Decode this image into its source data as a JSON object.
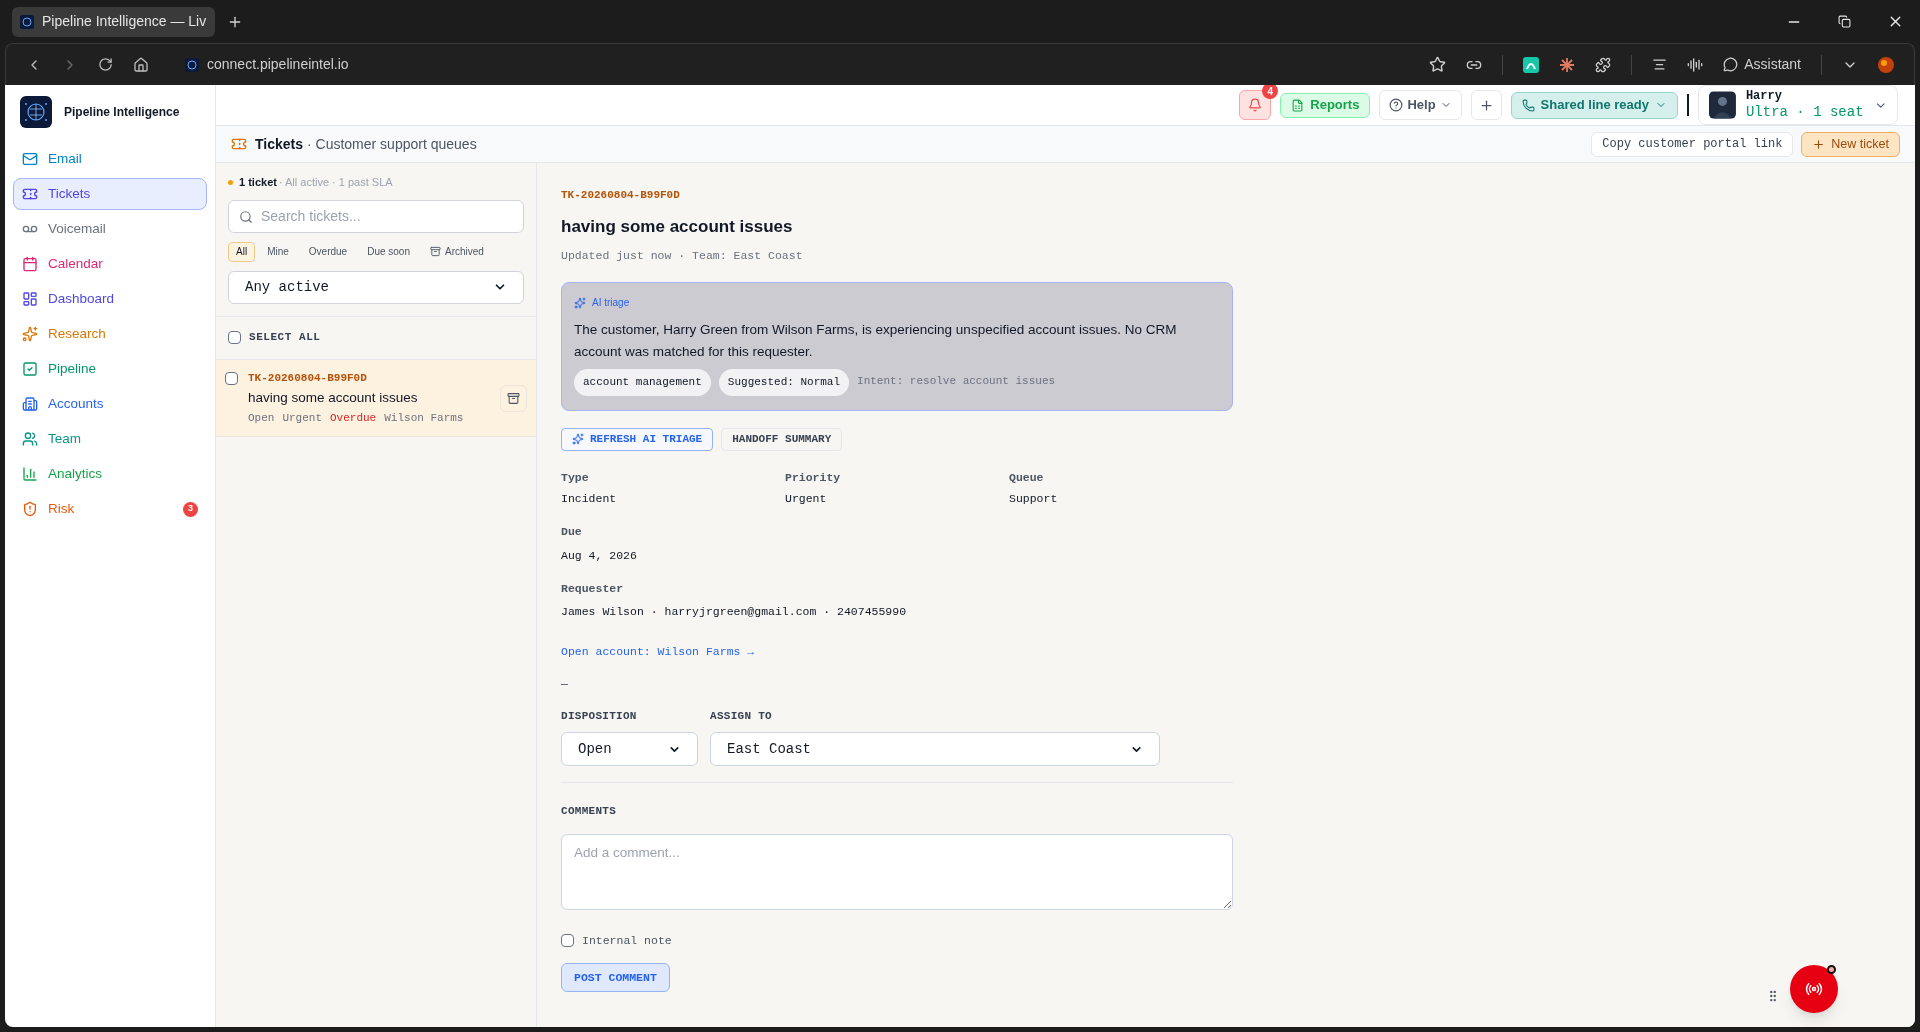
{
  "browser": {
    "tab_title": "Pipeline Intelligence — Liv",
    "url": "connect.pipelineintel.io",
    "assistant": "Assistant"
  },
  "sidebar": {
    "brand": "Pipeline Intelligence",
    "items": [
      {
        "label": "Email",
        "color": "#0284c7",
        "selected": false
      },
      {
        "label": "Tickets",
        "color": "#4f46e5",
        "selected": true
      },
      {
        "label": "Voicemail",
        "color": "#6b7280",
        "selected": false
      },
      {
        "label": "Calendar",
        "color": "#db2777",
        "selected": false
      },
      {
        "label": "Dashboard",
        "color": "#4f46e5",
        "selected": false
      },
      {
        "label": "Research",
        "color": "#d97706",
        "selected": false
      },
      {
        "label": "Pipeline",
        "color": "#059669",
        "selected": false
      },
      {
        "label": "Accounts",
        "color": "#2563eb",
        "selected": false
      },
      {
        "label": "Team",
        "color": "#0d9488",
        "selected": false
      },
      {
        "label": "Analytics",
        "color": "#16a34a",
        "selected": false
      },
      {
        "label": "Risk",
        "color": "#ea580c",
        "selected": false,
        "badge": "3"
      }
    ]
  },
  "header": {
    "notification_count": "4",
    "reports": "Reports",
    "help": "Help",
    "line_status": "Shared line ready",
    "user": {
      "name": "Harry",
      "plan": "Ultra · 1 seat"
    }
  },
  "subheader": {
    "title": "Tickets",
    "subtitle": "· Customer support queues",
    "copy_link": "Copy customer portal link",
    "new_ticket": "New ticket"
  },
  "list": {
    "count": "1 ticket",
    "summary": "· All active · 1 past SLA",
    "search": {
      "placeholder": "Search tickets..."
    },
    "filters": [
      {
        "label": "All",
        "selected": true,
        "kind": "text"
      },
      {
        "label": "Mine",
        "selected": false,
        "kind": "text"
      },
      {
        "label": "Overdue",
        "selected": false,
        "kind": "text"
      },
      {
        "label": "Due soon",
        "selected": false,
        "kind": "text"
      },
      {
        "label": "Archived",
        "selected": false,
        "kind": "archive"
      }
    ],
    "status_select": "Any active",
    "select_all": {
      "label": "SELECT ALL",
      "checked": false
    },
    "tickets": [
      {
        "id": "TK-20260804-B99F0D",
        "title": "having some account issues",
        "checked": false,
        "selected": true,
        "tags": [
          {
            "text": "Open",
            "color": "#6b7280"
          },
          {
            "text": "Urgent",
            "color": "#6b7280"
          },
          {
            "text": "Overdue",
            "color": "#dc2626"
          },
          {
            "text": "Wilson Farms",
            "color": "#6b7280"
          }
        ]
      }
    ]
  },
  "detail": {
    "id": "TK-20260804-B99F0D",
    "title": "having some account issues",
    "meta": "Updated just now · Team: East Coast",
    "ai_triage": {
      "label": "AI triage",
      "summary": "The customer, Harry Green from Wilson Farms, is experiencing unspecified account issues. No CRM account was matched for this requester.",
      "chips": [
        "account management",
        "Suggested: Normal"
      ],
      "intent": "Intent: resolve account issues"
    },
    "actions": [
      {
        "label": "REFRESH AI TRIAGE",
        "kind": "primary"
      },
      {
        "label": "HANDOFF SUMMARY",
        "kind": "plain"
      }
    ],
    "fields": [
      {
        "label": "Type",
        "value": "Incident"
      },
      {
        "label": "Priority",
        "value": "Urgent"
      },
      {
        "label": "Queue",
        "value": "Support"
      }
    ],
    "due": {
      "label": "Due",
      "value": "Aug 4, 2026"
    },
    "requester": {
      "label": "Requester",
      "value": "James Wilson · harryjrgreen@gmail.com · 2407455990"
    },
    "account_link": "Open account: Wilson Farms →",
    "dash": "—",
    "disposition": {
      "label": "DISPOSITION",
      "value": "Open"
    },
    "assign_to": {
      "label": "ASSIGN TO",
      "value": "East Coast"
    },
    "comments": {
      "label": "COMMENTS",
      "placeholder": "Add a comment...",
      "internal_note": {
        "label": "Internal note",
        "checked": false
      },
      "post": "POST COMMENT"
    }
  }
}
